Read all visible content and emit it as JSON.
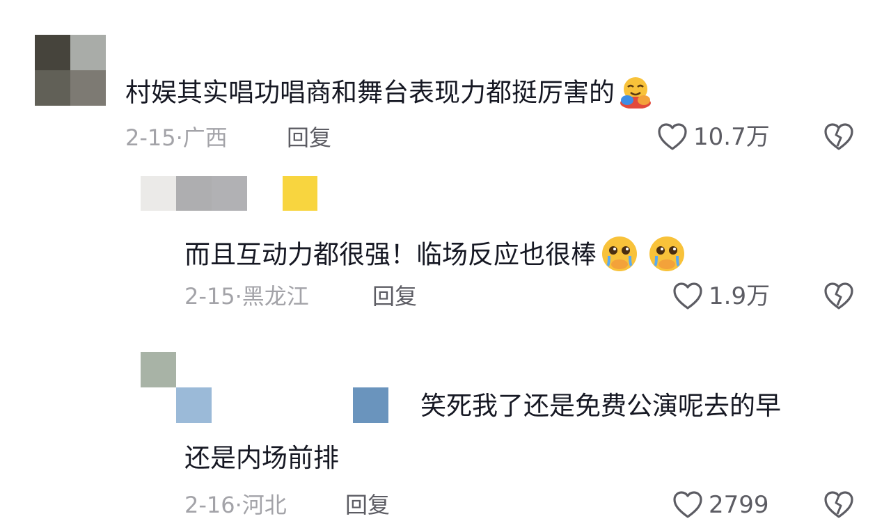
{
  "comments": [
    {
      "text": "村娱其实唱功唱商和舞台表现力都挺厉害的",
      "emoji": "hugging-face-emoji",
      "date": "2-15",
      "separator": "·",
      "location": "广西",
      "reply_label": "回复",
      "likes": "10.7万"
    },
    {
      "text": "而且互动力都很强！临场反应也很棒",
      "emoji": "pleading-face-emoji",
      "date": "2-15",
      "separator": "·",
      "location": "黑龙江",
      "reply_label": "回复",
      "likes": "1.9万"
    },
    {
      "text_line1": "笑死我了还是免费公演呢去的早",
      "text_line2": "还是内场前排",
      "date": "2-16",
      "separator": "·",
      "location": "河北",
      "reply_label": "回复",
      "likes": "2799"
    }
  ],
  "colors": {
    "text_primary": "#161823",
    "text_meta": "#a3a3a8",
    "text_action": "#5c5c63",
    "icon": "#5c5c63"
  }
}
